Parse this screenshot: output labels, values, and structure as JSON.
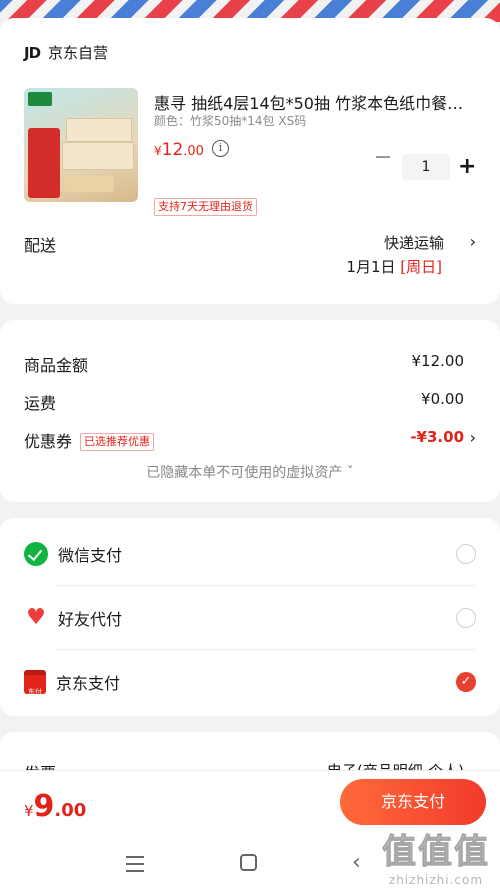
{
  "store": {
    "logo": "JD",
    "name": "京东自营"
  },
  "product": {
    "title": "惠寻 抽纸4层14包*50抽 竹浆本色纸巾餐…",
    "spec": "颜色：竹浆50抽*14包 XS码",
    "price_symbol": "¥",
    "price_int": "12",
    "price_dec": ".00",
    "info_icon": "i",
    "quantity": "1",
    "return_policy": "支持7天无理由退货"
  },
  "shipping": {
    "label": "配送",
    "method": "快递运输",
    "date": "1月1日",
    "weekday": "[周日]"
  },
  "summary": {
    "goods_label": "商品金额",
    "goods_value": "¥12.00",
    "freight_label": "运费",
    "freight_value": "¥0.00",
    "coupon_label": "优惠券",
    "coupon_tag": "已选推荐优惠",
    "coupon_value": "-¥3.00",
    "hidden_assets": "已隐藏本单不可使用的虚拟资产 ˇ"
  },
  "payment": {
    "options": [
      {
        "name": "微信支付",
        "selected": false
      },
      {
        "name": "好友代付",
        "selected": false
      },
      {
        "name": "京东支付",
        "selected": true
      }
    ],
    "jd_icon_text": "东付"
  },
  "invoice": {
    "label": "发票",
    "value": "电子(商品明细-个人)"
  },
  "footer": {
    "total_symbol": "¥",
    "total_int": "9",
    "total_dec": ".00",
    "pay_button": "京东支付"
  },
  "watermark": {
    "big": "值值值",
    "small": "zhizhizhi.com"
  },
  "colors": {
    "accent_red": "#e2231a",
    "pay_gradient_start": "#ff6a3a",
    "pay_gradient_end": "#f23b2b",
    "wechat_green": "#0fb340"
  }
}
